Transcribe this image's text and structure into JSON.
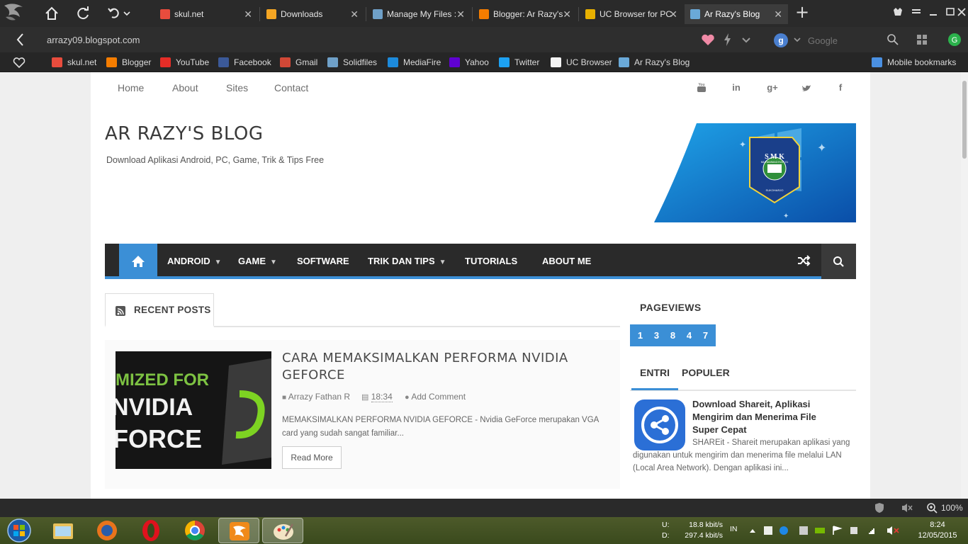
{
  "browser": {
    "tabs": [
      {
        "title": "skul.net",
        "color": "#e84c3d"
      },
      {
        "title": "Downloads",
        "color": "#f5a623"
      },
      {
        "title": "Manage My Files :",
        "color": "#6fa0c8"
      },
      {
        "title": "Blogger: Ar Razy's",
        "color": "#f57d00"
      },
      {
        "title": "UC Browser for PC",
        "color": "#e8b100"
      },
      {
        "title": "Ar Razy's Blog",
        "color": "#6aa9d8"
      }
    ],
    "address": "arrazy09.blogspot.com",
    "search_placeholder": "Google",
    "bookmarks": [
      {
        "label": "skul.net",
        "color": "#e84c3d"
      },
      {
        "label": "Blogger",
        "color": "#f57d00"
      },
      {
        "label": "YouTube",
        "color": "#e52d27"
      },
      {
        "label": "Facebook",
        "color": "#3b5998"
      },
      {
        "label": "Gmail",
        "color": "#d14836"
      },
      {
        "label": "Solidfiles",
        "color": "#6fa0c8"
      },
      {
        "label": "MediaFire",
        "color": "#1c8adb"
      },
      {
        "label": "Yahoo",
        "color": "#5f01d1"
      },
      {
        "label": "Twitter",
        "color": "#1da1f2"
      },
      {
        "label": "UC Browser",
        "color": "#f4f4f4"
      },
      {
        "label": "Ar Razy's Blog",
        "color": "#6aa9d8"
      }
    ],
    "mobile_bookmarks": "Mobile bookmarks",
    "zoom": "100%"
  },
  "blog": {
    "top_nav": [
      "Home",
      "About",
      "Sites",
      "Contact"
    ],
    "title": "AR RAZY'S BLOG",
    "description": "Download Aplikasi Android, PC, Game, Trik & Tips Free",
    "banner_text": {
      "top": "S M K",
      "middle": "MUHAMMADIYAH 01",
      "bottom": "SUKOHARJO"
    },
    "main_nav": [
      "ANDROID",
      "GAME",
      "SOFTWARE",
      "TRIK DAN TIPS",
      "TUTORIALS",
      "ABOUT ME"
    ],
    "recent_posts_label": "RECENT POSTS",
    "post": {
      "title": "CARA MEMAKSIMALKAN PERFORMA NVIDIA GEFORCE",
      "author": "Arrazy Fathan R",
      "time": "18:34",
      "comment": "Add Comment",
      "excerpt": "MEMAKSIMALKAN PERFORMA NVIDIA GEFORCE - Nvidia GeForce merupakan VGA card yang sudah sangat familiar...",
      "read_more": "Read More",
      "thumb_lines": [
        "MIZED FOR",
        "NVIDIA",
        "FORCE"
      ]
    },
    "sidebar": {
      "pageviews_label": "PAGEVIEWS",
      "pageviews_digits": [
        "1",
        "3",
        "8",
        "4",
        "7"
      ],
      "tabs": [
        "ENTRI",
        "POPULER"
      ],
      "popular_title": "Download Shareit, Aplikasi Mengirim dan Menerima File Super Cepat",
      "popular_text": "SHAREit - Shareit merupakan aplikasi yang digunakan untuk mengirim dan menerima file melalui LAN (Local Area Network). Dengan aplikasi ini..."
    }
  },
  "taskbar": {
    "upload_label": "U:",
    "download_label": "D:",
    "upload": "18.8 kbit/s",
    "download": "297.4 kbit/s",
    "lang": "IN",
    "time": "8:24",
    "date": "12/05/2015"
  }
}
